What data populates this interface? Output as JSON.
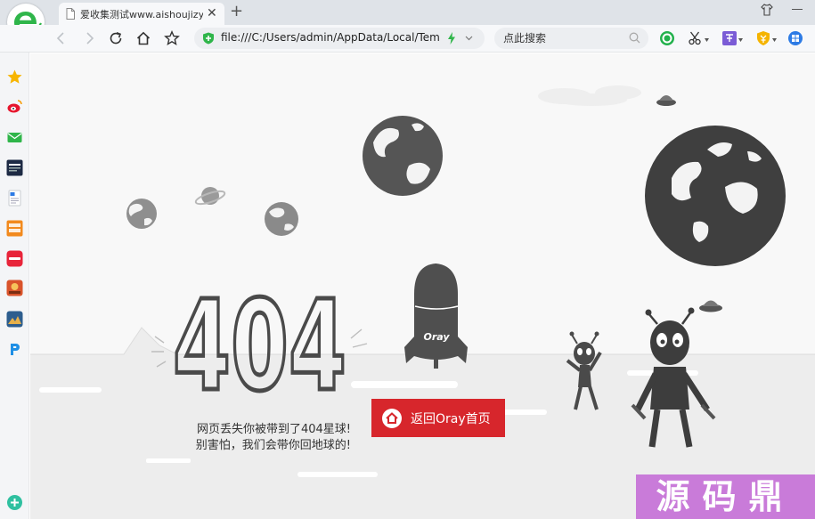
{
  "tab": {
    "title": "爱收集测试www.aishoujizy.cc",
    "close_glyph": "✕",
    "new_glyph": "+"
  },
  "address_bar": {
    "url": "file:///C:/Users/admin/AppData/Local/Tem"
  },
  "search": {
    "placeholder": "点此搜索"
  },
  "page": {
    "error_code": "404",
    "rocket_brand": "Oray",
    "message_line1": "网页丢失你被带到了404星球!",
    "message_line2": "别害怕，我们会带你回地球的!",
    "home_button_label": "返回Oray首页"
  },
  "watermark": {
    "text": "源码鼎"
  },
  "icons": [
    "browser-logo-icon",
    "document-icon",
    "close-icon",
    "plus-icon",
    "shirt-icon",
    "minimize-icon",
    "back-icon",
    "forward-icon",
    "refresh-icon",
    "home-icon",
    "star-icon",
    "shield-icon",
    "lightning-icon",
    "chevron-down-icon",
    "search-icon",
    "green-circle-icon",
    "scissors-icon",
    "translate-icon",
    "shield-coin-icon",
    "browser-app-icon"
  ],
  "colors": {
    "accent_red": "#d7262c",
    "browser_green": "#2fb54a",
    "watermark": "#c97bd9",
    "planet": "#4a4a4a"
  }
}
